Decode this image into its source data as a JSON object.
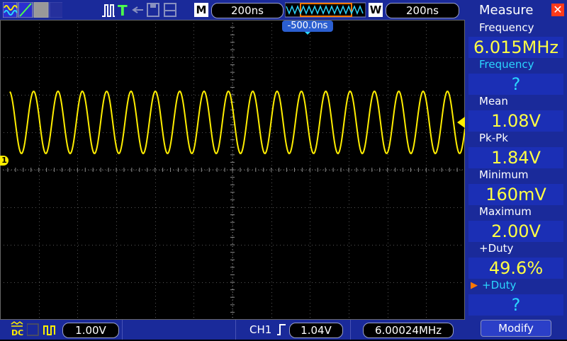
{
  "toolbar": {
    "timebase_tag": "M",
    "timebase_value": "200ns",
    "window_tag": "W",
    "window_value": "200ns",
    "trigger_run_icon": "trigger-T-icon"
  },
  "screen": {
    "trigger_offset": "-500.0ns",
    "channel_marker": "1"
  },
  "measure": {
    "title": "Measure",
    "items": [
      {
        "label": "Frequency",
        "value": "6.015MHz"
      },
      {
        "label": "Frequency",
        "value": "?"
      },
      {
        "label": "Mean",
        "value": "1.08V"
      },
      {
        "label": "Pk-Pk",
        "value": "1.84V"
      },
      {
        "label": "Minimum",
        "value": "160mV"
      },
      {
        "label": "Maximum",
        "value": "2.00V"
      },
      {
        "label": "+Duty",
        "value": "49.6%"
      },
      {
        "label": "+Duty",
        "value": "?"
      }
    ],
    "modify_label": "Modify"
  },
  "bottom": {
    "coupling": "DC",
    "volts_div": "1.00V",
    "trigger_channel": "CH1",
    "trigger_level": "1.04V",
    "trigger_freq": "6.00024MHz"
  },
  "colors": {
    "trace": "#ffee00",
    "bar": "#1a2a9a",
    "cyan": "#2bd6ff"
  }
}
